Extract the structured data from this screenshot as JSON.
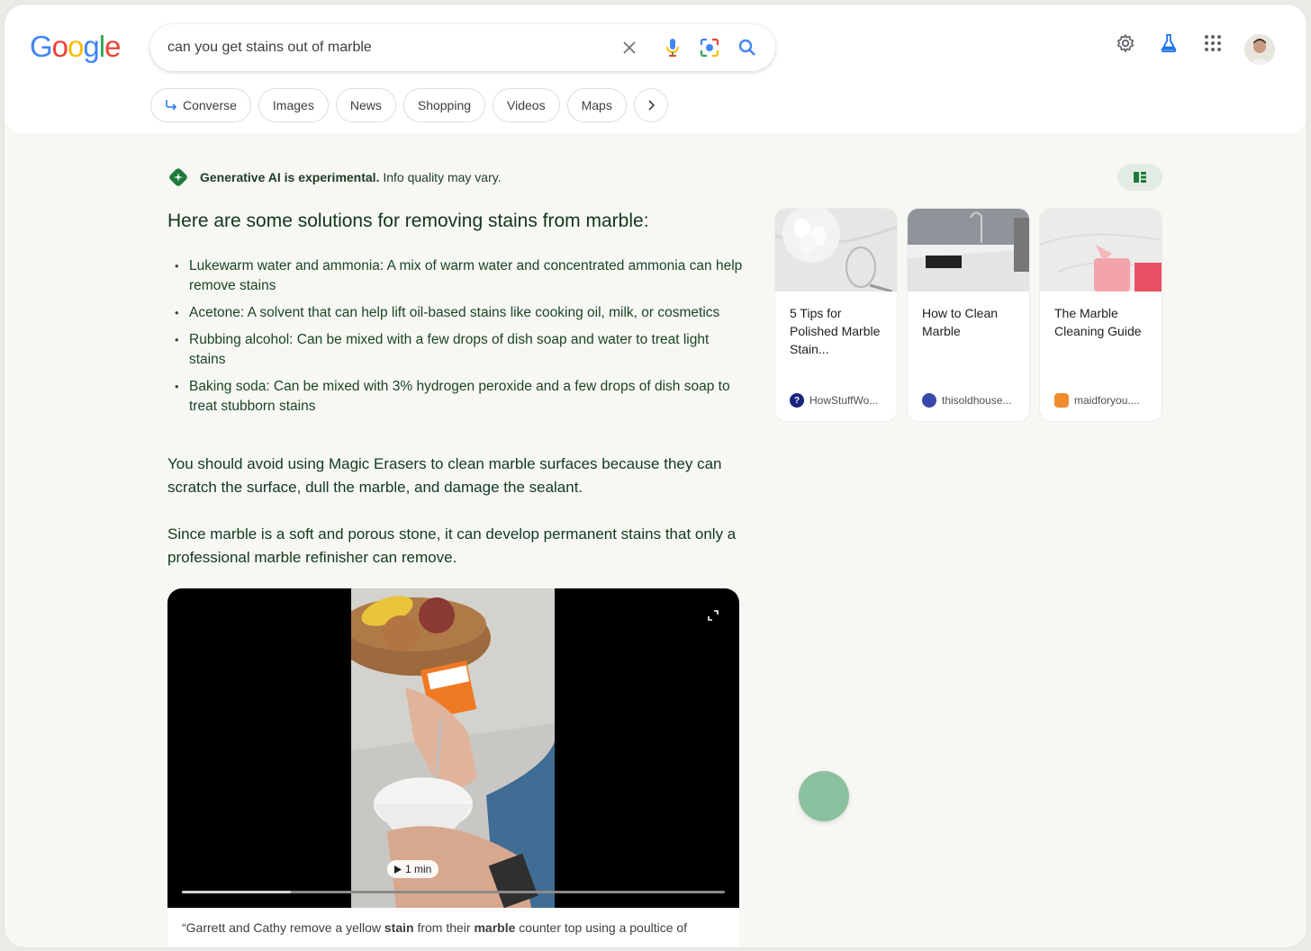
{
  "logo": {
    "letters": [
      "G",
      "o",
      "o",
      "g",
      "l",
      "e"
    ]
  },
  "search": {
    "query": "can you get stains out of marble"
  },
  "chips": [
    {
      "label": "Converse"
    },
    {
      "label": "Images"
    },
    {
      "label": "News"
    },
    {
      "label": "Shopping"
    },
    {
      "label": "Videos"
    },
    {
      "label": "Maps"
    }
  ],
  "ai": {
    "banner_bold": "Generative AI is experimental.",
    "banner_rest": " Info quality may vary.",
    "heading": "Here are some solutions for removing stains from marble:",
    "bullets": [
      "Lukewarm water and ammonia: A mix of warm water and concentrated ammonia can help remove stains",
      "Acetone: A solvent that can help lift oil-based stains like cooking oil, milk, or cosmetics",
      "Rubbing alcohol: Can be mixed with a few drops of dish soap and water to treat light stains",
      "Baking soda: Can be mixed with 3% hydrogen peroxide and a few drops of dish soap to treat stubborn stains"
    ],
    "para1": "You should avoid using Magic Erasers to clean marble surfaces because they can scratch the surface, dull the marble, and damage the sealant.",
    "para2": "Since marble is a soft and porous stone, it can develop permanent stains that only a professional marble refinisher can remove."
  },
  "video": {
    "duration": "1 min",
    "progress_fraction": 0.2,
    "caption_prefix": "“Garrett and Cathy remove a yellow ",
    "caption_bold1": "stain",
    "caption_mid": " from their ",
    "caption_bold2": "marble",
    "caption_suffix": " counter top using a poultice of"
  },
  "cards": [
    {
      "title": "5 Tips for Polished Marble Stain...",
      "source": "HowStuffWo...",
      "fav_color": "#1a237e"
    },
    {
      "title": "How to Clean Marble",
      "source": "thisoldhouse...",
      "fav_color": "#3949ab"
    },
    {
      "title": "The Marble Cleaning Guide",
      "source": "maidforyou....",
      "fav_color": "#f28b30"
    }
  ],
  "colors": {
    "brand_blue": "#4285f4",
    "brand_red": "#ea4335",
    "brand_yellow": "#fbbc05",
    "brand_green": "#34a853",
    "ai_green": "#1e7a3c",
    "fab": "#8cc19f"
  }
}
